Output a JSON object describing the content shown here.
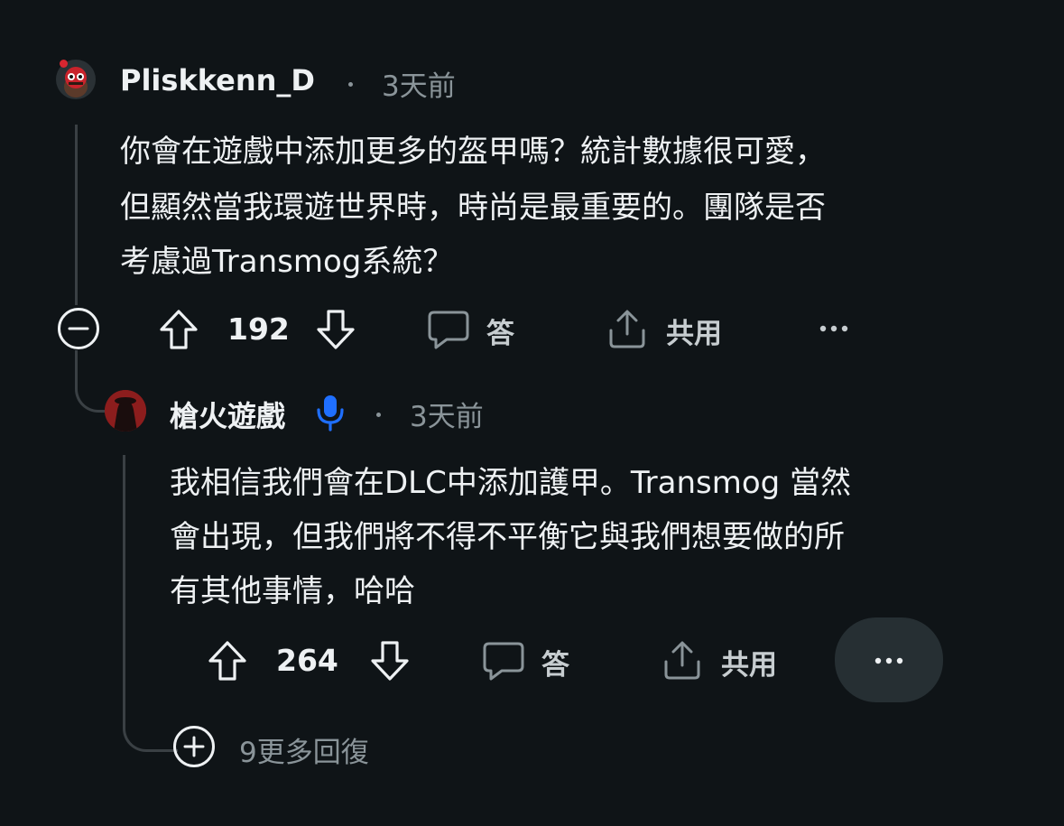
{
  "comment": {
    "username": "Pliskkenn_D",
    "time": "3天前",
    "lines": [
      "你會在遊戲中添加更多的盔甲嗎？統計數據很可愛，",
      "但顯然當我環遊世界時，時尚是最重要的。團隊是否",
      "考慮過Transmog系統？"
    ],
    "score": "192",
    "reply_label": "答",
    "share_label": "共用"
  },
  "reply": {
    "username": "槍火遊戲",
    "time": "3天前",
    "lines": [
      "我相信我們會在DLC中添加護甲。Transmog 當然",
      "會出現，但我們將不得不平衡它與我們想要做的所",
      "有其他事情，哈哈"
    ],
    "score": "264",
    "reply_label": "答",
    "share_label": "共用"
  },
  "more_replies": "9更多回復",
  "colors": {
    "background": "#0f1417",
    "mic_badge": "#1f6fff"
  }
}
